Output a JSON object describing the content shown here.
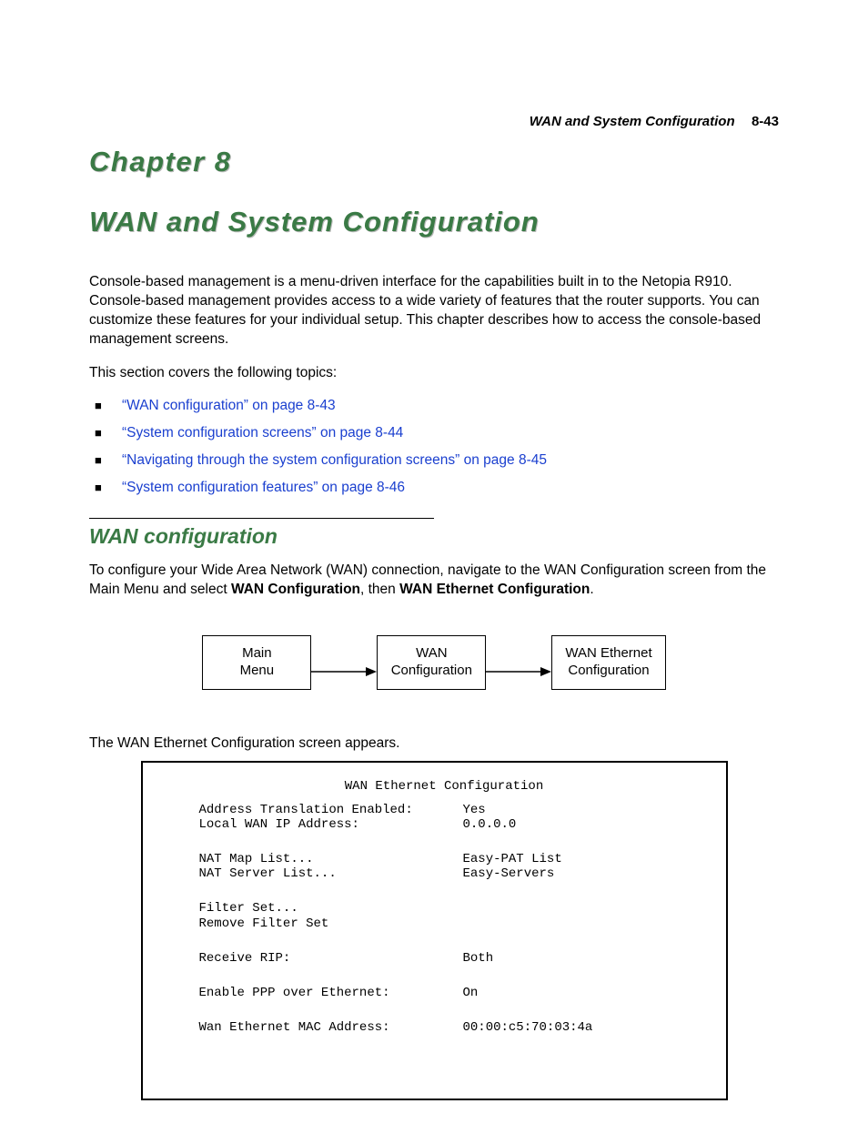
{
  "header": {
    "running_title": "WAN and System Configuration",
    "page_number": "8-43"
  },
  "chapter_label": "Chapter 8",
  "chapter_title": "WAN and System Configuration",
  "intro": "Console-based management is a menu-driven interface for the capabilities built in to the Netopia R910. Console-based management provides access to a wide variety of features that the router supports. You can customize these features for your individual setup. This chapter describes how to access the console-based management screens.",
  "topics_lead": "This section covers the following topics:",
  "topics": [
    "“WAN configuration” on page 8-43",
    "“System configuration screens” on page 8-44",
    "“Navigating through the system configuration screens” on page 8-45",
    "“System configuration features” on page 8-46"
  ],
  "section": {
    "title": "WAN configuration",
    "body_pre": "To configure your Wide Area Network (WAN) connection, navigate to the WAN Configuration screen from the Main Menu and select ",
    "bold1": "WAN Configuration",
    "body_mid": ", then ",
    "bold2": "WAN Ethernet Configuration",
    "body_post": "."
  },
  "nav": {
    "box1_l1": "Main",
    "box1_l2": "Menu",
    "box2_l1": "WAN",
    "box2_l2": "Configuration",
    "box3_l1": "WAN Ethernet",
    "box3_l2": "Configuration"
  },
  "terminal_caption": "The WAN Ethernet Configuration screen appears.",
  "terminal": {
    "title": "WAN Ethernet Configuration",
    "rows": {
      "addr_trans_lbl": "Address Translation Enabled:",
      "addr_trans_val": "Yes",
      "local_wan_lbl": "Local WAN IP Address:",
      "local_wan_val": "0.0.0.0",
      "nat_map_lbl": "NAT Map List...",
      "nat_map_val": "Easy-PAT List",
      "nat_srv_lbl": "NAT Server List...",
      "nat_srv_val": "Easy-Servers",
      "filter_set": "Filter Set...",
      "remove_filter": "Remove Filter Set",
      "recv_rip_lbl": "Receive RIP:",
      "recv_rip_val": "Both",
      "ppp_lbl": "Enable PPP over Ethernet:",
      "ppp_val": "On",
      "mac_lbl": "Wan Ethernet MAC Address:",
      "mac_val": "00:00:c5:70:03:4a"
    }
  }
}
